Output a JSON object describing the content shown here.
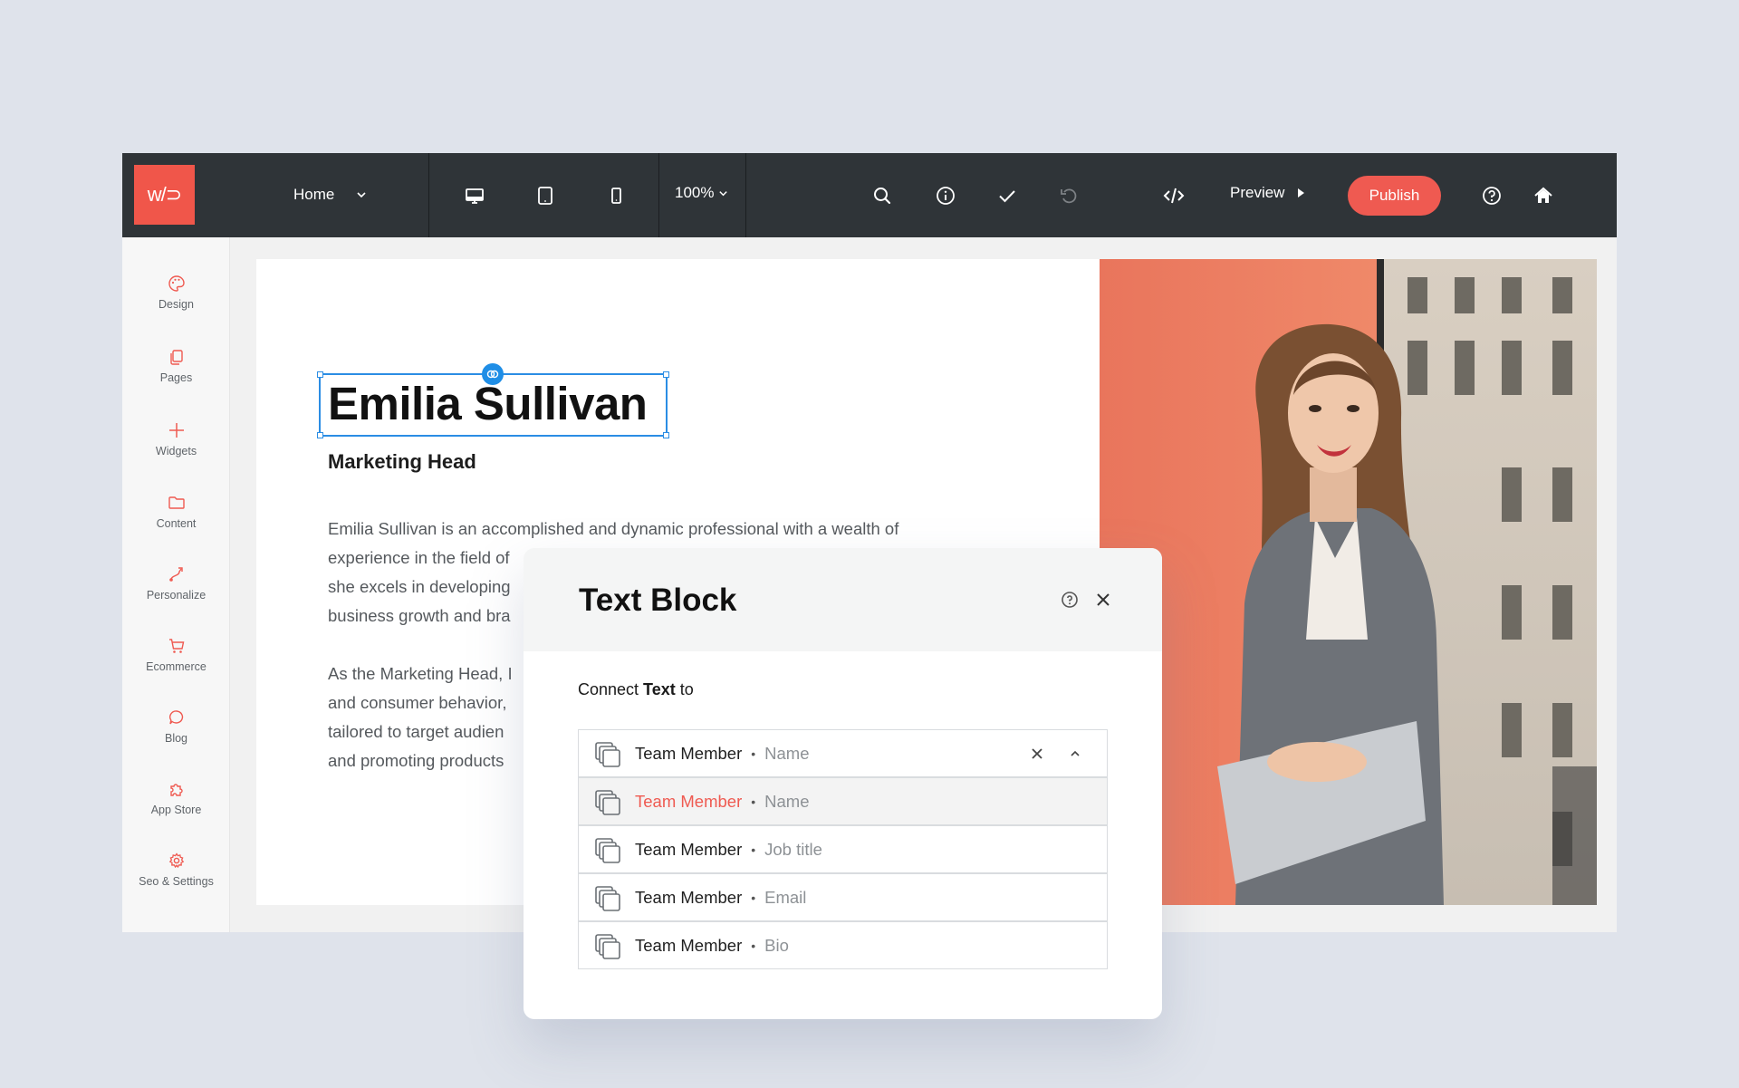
{
  "app": {
    "logo_text": "w/⊃",
    "accent_color": "#ef5a51",
    "topbar_color": "#2f3438"
  },
  "topbar": {
    "page_label": "Home",
    "zoom_label": "100%",
    "preview_label": "Preview",
    "publish_label": "Publish",
    "icons": [
      "desktop-icon",
      "tablet-icon",
      "mobile-icon",
      "search-icon",
      "info-icon",
      "check-icon",
      "undo-icon",
      "code-icon",
      "help-icon",
      "home-icon"
    ]
  },
  "sidebar": {
    "items": [
      {
        "label": "Design",
        "icon": "palette-icon"
      },
      {
        "label": "Pages",
        "icon": "pages-icon"
      },
      {
        "label": "Widgets",
        "icon": "plus-icon"
      },
      {
        "label": "Content",
        "icon": "folder-icon"
      },
      {
        "label": "Personalize",
        "icon": "personalize-icon"
      },
      {
        "label": "Ecommerce",
        "icon": "cart-icon"
      },
      {
        "label": "Blog",
        "icon": "chat-icon"
      },
      {
        "label": "App Store",
        "icon": "puzzle-icon"
      },
      {
        "label": "Seo & Settings",
        "icon": "gear-icon"
      }
    ]
  },
  "canvas": {
    "name": "Emilia Sullivan",
    "role": "Marketing Head",
    "bio_paragraph_1": [
      "Emilia Sullivan is an accomplished and dynamic professional with a wealth of",
      "experience in the field of",
      "she excels in developing",
      "business growth and bra"
    ],
    "bio_paragraph_2": [
      "As the Marketing Head, I",
      "and consumer behavior,",
      "tailored to target audien",
      "and promoting products"
    ]
  },
  "panel": {
    "title": "Text Block",
    "connect_prefix": "Connect ",
    "connect_bold": "Text",
    "connect_suffix": " to",
    "selected": {
      "source": "Team Member",
      "field": "Name"
    },
    "options": [
      {
        "source": "Team Member",
        "field": "Name"
      },
      {
        "source": "Team Member",
        "field": "Job title"
      },
      {
        "source": "Team Member",
        "field": "Email"
      },
      {
        "source": "Team Member",
        "field": "Bio"
      }
    ]
  }
}
